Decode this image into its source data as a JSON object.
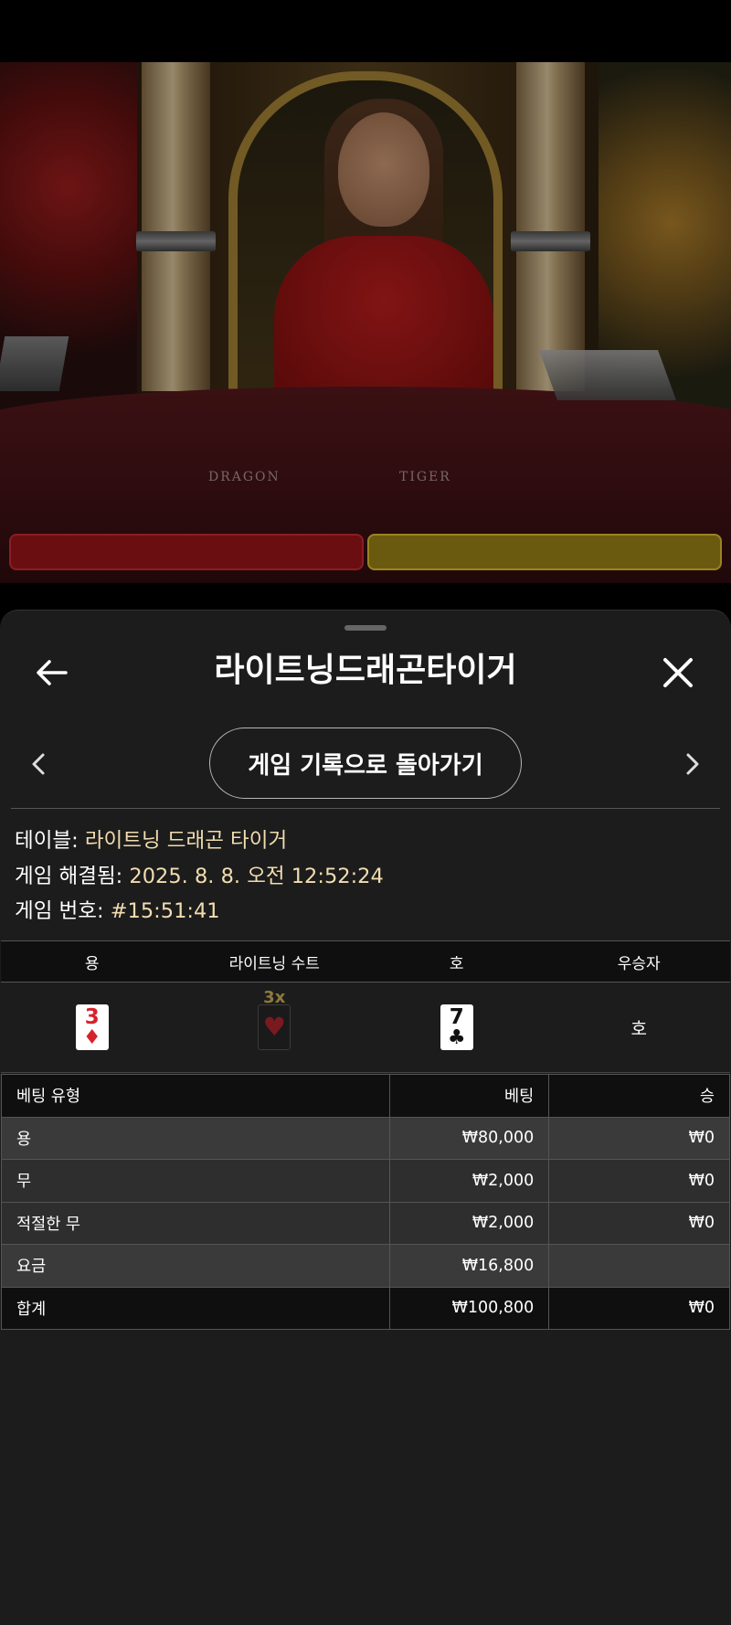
{
  "header": {
    "title": "라이트닝드래곤타이거"
  },
  "video": {
    "table_label_dragon": "DRAGON",
    "table_label_tiger": "TIGER"
  },
  "navigation": {
    "history_button": "게임 기록으로 돌아가기"
  },
  "info": {
    "table_label": "테이블:",
    "table_value": "라이트닝 드래곤 타이거",
    "resolved_label": "게임 해결됨:",
    "resolved_value": "2025. 8. 8. 오전 12:52:24",
    "number_label": "게임 번호:",
    "number_value": "#15:51:41"
  },
  "results": {
    "headers": [
      "용",
      "라이트닝 수트",
      "호",
      "우승자"
    ],
    "dragon_card": {
      "rank": "3",
      "suit": "♦"
    },
    "lightning_suit": {
      "multiplier": "3x",
      "suit": "♥"
    },
    "tiger_card": {
      "rank": "7",
      "suit": "♣"
    },
    "winner": "호"
  },
  "bets": {
    "headers": [
      "베팅 유형",
      "베팅",
      "승"
    ],
    "rows": [
      {
        "type": "용",
        "bet": "₩80,000",
        "win": "₩0"
      },
      {
        "type": "무",
        "bet": "₩2,000",
        "win": "₩0"
      },
      {
        "type": "적절한 무",
        "bet": "₩2,000",
        "win": "₩0"
      },
      {
        "type": "요금",
        "bet": "₩16,800",
        "win": ""
      }
    ],
    "total": {
      "type": "합계",
      "bet": "₩100,800",
      "win": "₩0"
    }
  },
  "colors": {
    "info_value": "#f2ddb0",
    "multiplier": "#8e7a3c",
    "red_suit": "#d8212b"
  }
}
